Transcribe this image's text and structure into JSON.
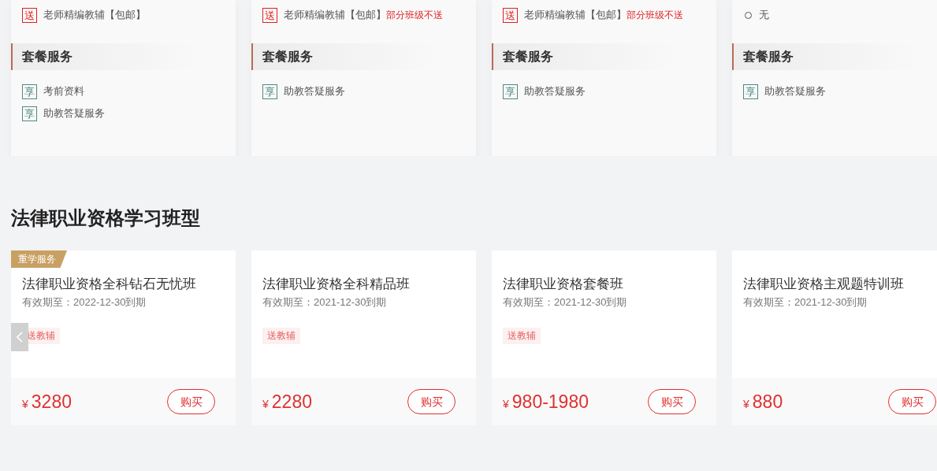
{
  "package_cards": [
    {
      "gifts": [
        {
          "kind": "gift",
          "icon": "送",
          "text": "老师精编教辅【包邮】"
        }
      ],
      "services_heading": "套餐服务",
      "services": [
        {
          "icon": "享",
          "text": "考前资料"
        },
        {
          "icon": "享",
          "text": "助教答疑服务"
        }
      ]
    },
    {
      "gifts": [
        {
          "kind": "gift",
          "icon": "送",
          "text": "老师精编教辅【包邮】",
          "note": "部分班级不送"
        }
      ],
      "services_heading": "套餐服务",
      "services": [
        {
          "icon": "享",
          "text": "助教答疑服务"
        }
      ]
    },
    {
      "gifts": [
        {
          "kind": "gift",
          "icon": "送",
          "text": "老师精编教辅【包邮】",
          "note": "部分班级不送"
        }
      ],
      "services_heading": "套餐服务",
      "services": [
        {
          "icon": "享",
          "text": "助教答疑服务"
        }
      ]
    },
    {
      "gifts": [
        {
          "kind": "none",
          "text": "无"
        }
      ],
      "services_heading": "套餐服务",
      "services": [
        {
          "icon": "享",
          "text": "助教答疑服务"
        }
      ]
    }
  ],
  "course_section": {
    "title": "法律职业资格学习班型",
    "courses": [
      {
        "badge": "重学服务",
        "name": "法律职业资格全科钻石无忧班",
        "validity": "有效期至：2022-12-30到期",
        "tags": [
          "送教辅"
        ],
        "currency": "¥",
        "price": "3280",
        "buy_label": "购买"
      },
      {
        "name": "法律职业资格全科精品班",
        "validity": "有效期至：2021-12-30到期",
        "tags": [
          "送教辅"
        ],
        "currency": "¥",
        "price": "2280",
        "buy_label": "购买"
      },
      {
        "name": "法律职业资格套餐班",
        "validity": "有效期至：2021-12-30到期",
        "tags": [
          "送教辅"
        ],
        "currency": "¥",
        "price": "980-1980",
        "buy_label": "购买"
      },
      {
        "name": "法律职业资格主观题特训班",
        "validity": "有效期至：2021-12-30到期",
        "currency": "¥",
        "price": "880",
        "buy_label": "购买"
      }
    ]
  }
}
